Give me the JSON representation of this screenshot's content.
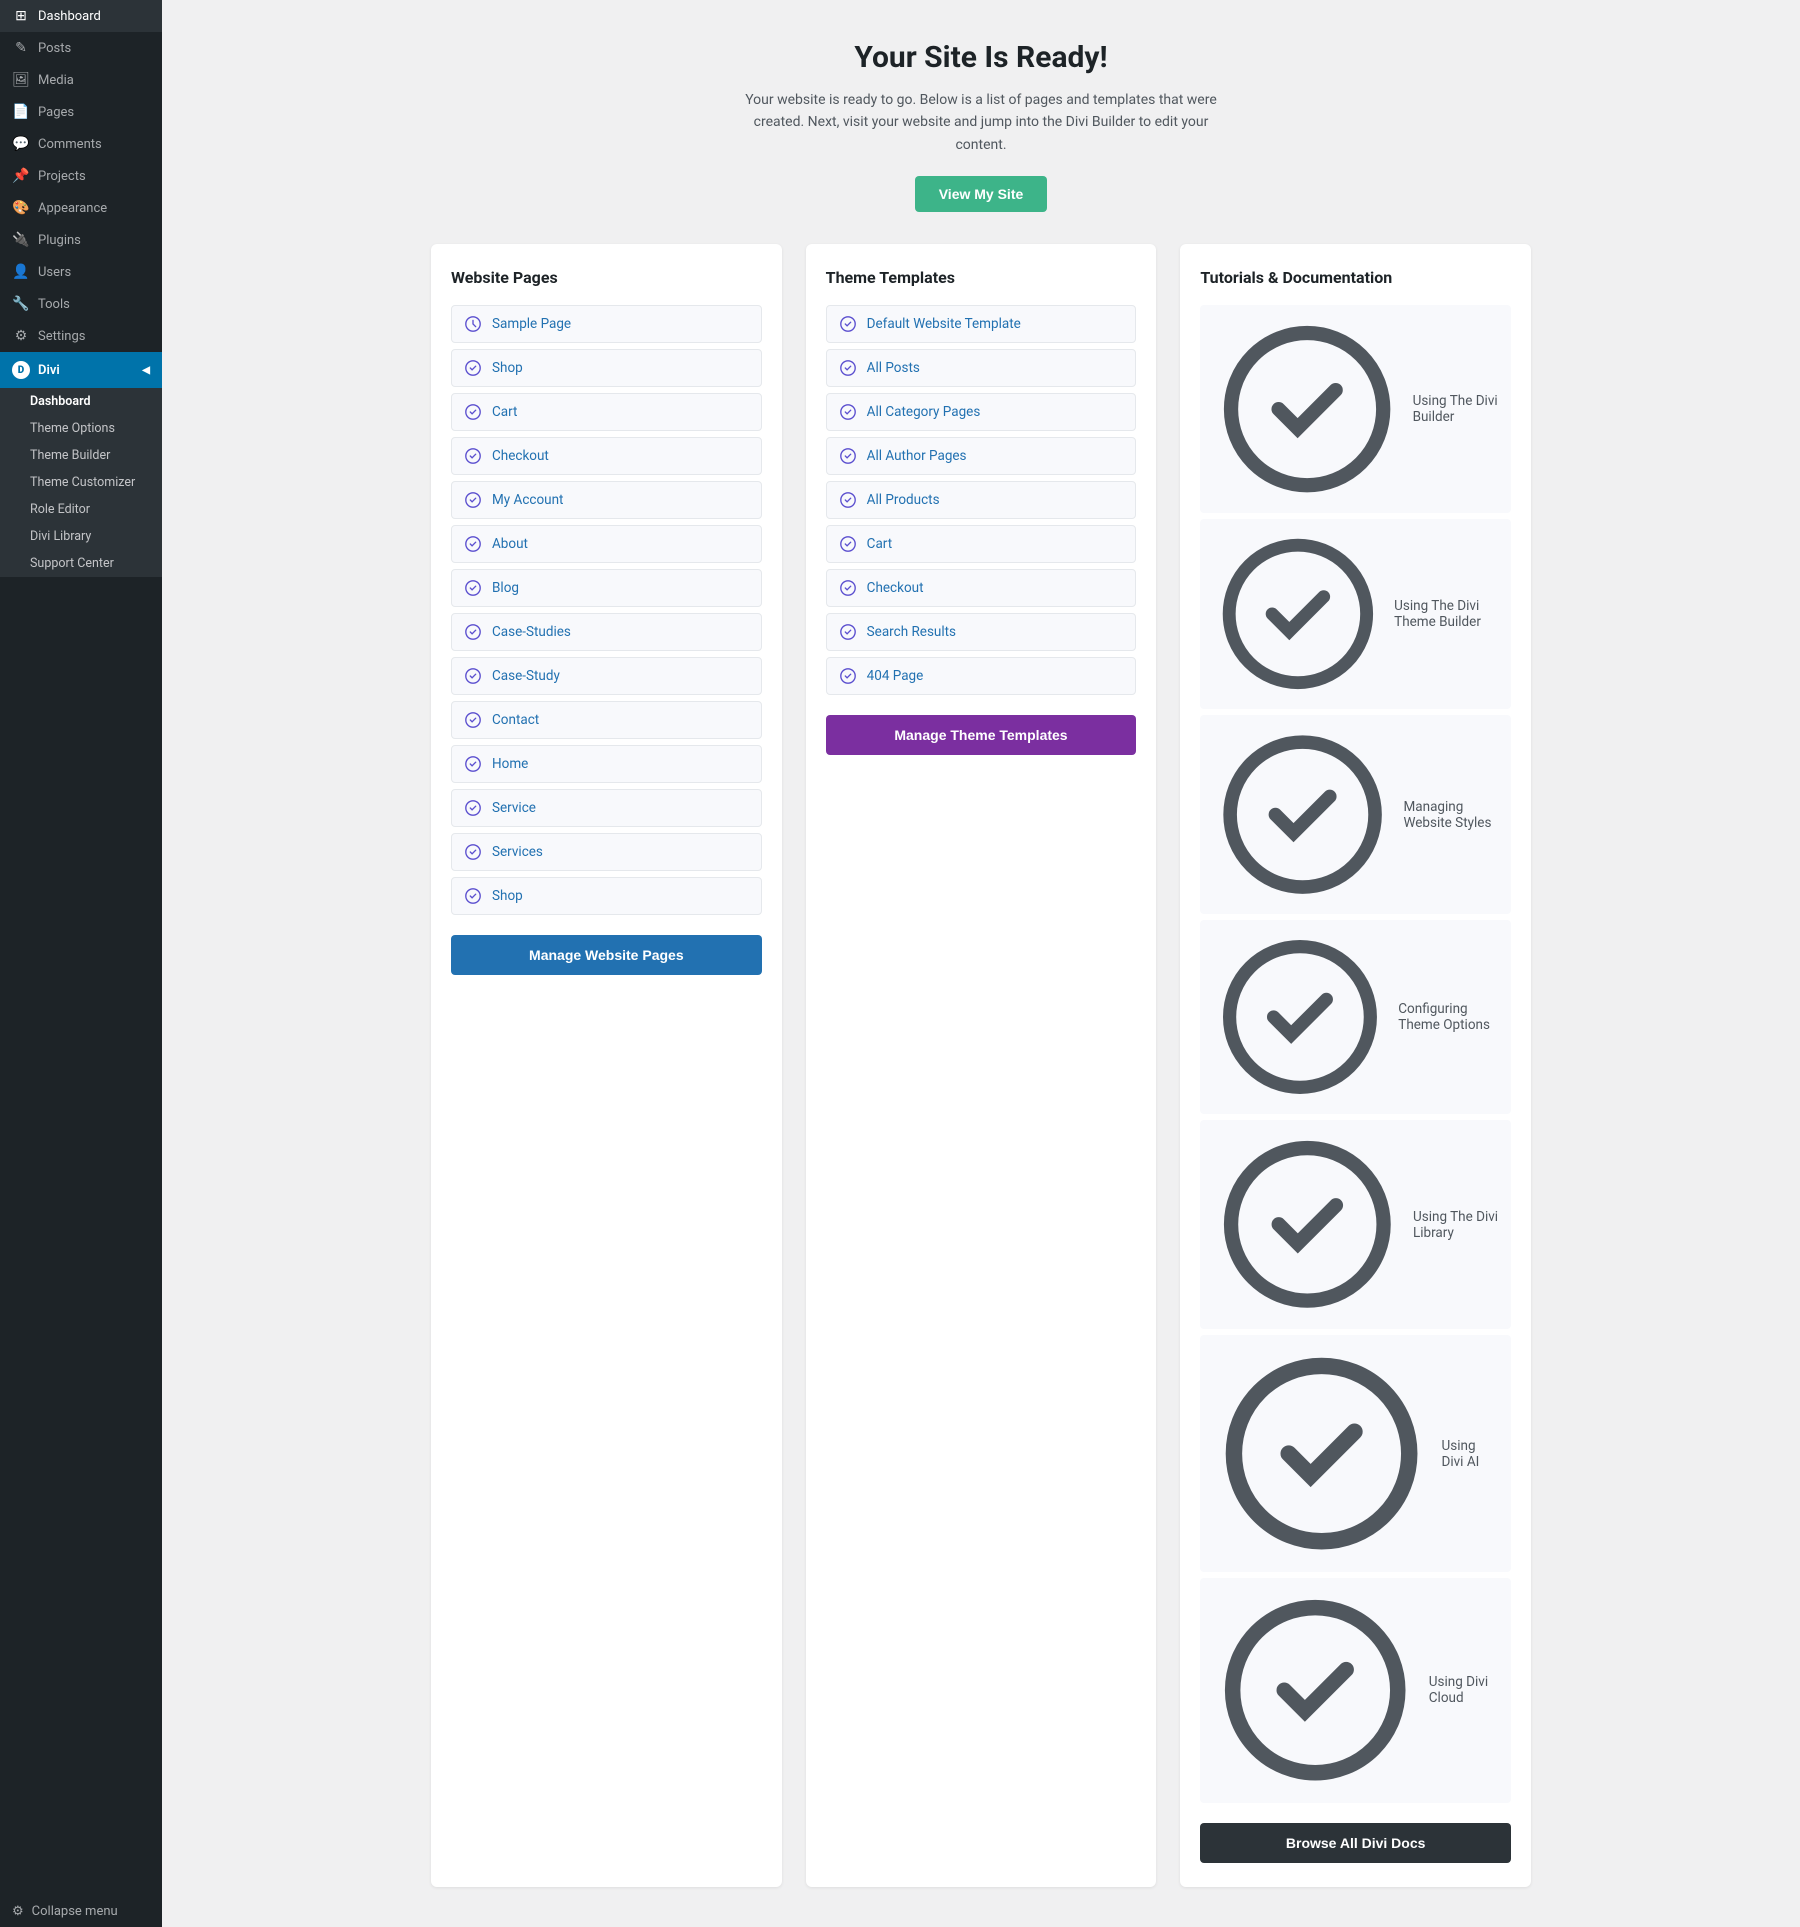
{
  "sidebar": {
    "items": [
      {
        "label": "Dashboard",
        "icon": "⊞",
        "active": false
      },
      {
        "label": "Posts",
        "icon": "✎",
        "active": false
      },
      {
        "label": "Media",
        "icon": "🖼",
        "active": false
      },
      {
        "label": "Pages",
        "icon": "📄",
        "active": false
      },
      {
        "label": "Comments",
        "icon": "💬",
        "active": false
      },
      {
        "label": "Projects",
        "icon": "📌",
        "active": false
      }
    ],
    "appearance": {
      "label": "Appearance",
      "icon": "🎨"
    },
    "plugins": {
      "label": "Plugins",
      "icon": "🔌"
    },
    "users": {
      "label": "Users",
      "icon": "👤"
    },
    "tools": {
      "label": "Tools",
      "icon": "🔧"
    },
    "settings": {
      "label": "Settings",
      "icon": "⚙"
    },
    "divi": {
      "label": "Divi",
      "sub_items": [
        {
          "label": "Dashboard",
          "active": true
        },
        {
          "label": "Theme Options",
          "active": false
        },
        {
          "label": "Theme Builder",
          "active": false
        },
        {
          "label": "Theme Customizer",
          "active": false
        },
        {
          "label": "Role Editor",
          "active": false
        },
        {
          "label": "Divi Library",
          "active": false
        },
        {
          "label": "Support Center",
          "active": false
        }
      ]
    },
    "collapse_label": "Collapse menu"
  },
  "main": {
    "title": "Your Site Is Ready!",
    "subtitle": "Your website is ready to go. Below is a list of pages and templates that were created. Next, visit your website and jump into the Divi Builder to edit your content.",
    "view_site_btn": "View My Site",
    "website_pages": {
      "heading": "Website Pages",
      "items": [
        "Sample Page",
        "Shop",
        "Cart",
        "Checkout",
        "My Account",
        "About",
        "Blog",
        "Case-Studies",
        "Case-Study",
        "Contact",
        "Home",
        "Service",
        "Services",
        "Shop"
      ],
      "btn_label": "Manage Website Pages"
    },
    "theme_templates": {
      "heading": "Theme Templates",
      "items": [
        "Default Website Template",
        "All Posts",
        "All Category Pages",
        "All Author Pages",
        "All Products",
        "Cart",
        "Checkout",
        "Search Results",
        "404 Page"
      ],
      "btn_label": "Manage Theme Templates"
    },
    "tutorials": {
      "heading": "Tutorials & Documentation",
      "items": [
        "Using The Divi Builder",
        "Using The Divi Theme Builder",
        "Managing Website Styles",
        "Configuring Theme Options",
        "Using The Divi Library",
        "Using Divi AI",
        "Using Divi Cloud"
      ],
      "btn_label": "Browse All Divi Docs"
    }
  }
}
